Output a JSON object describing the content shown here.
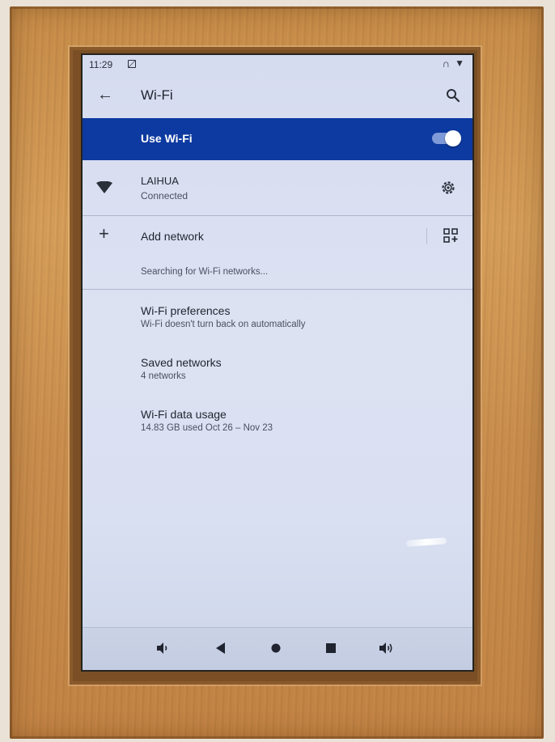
{
  "status_bar": {
    "time": "11:29",
    "notification_icon": "notification-square-icon",
    "right_icons": [
      "headset-icon",
      "wifi-icon"
    ]
  },
  "app_bar": {
    "title": "Wi-Fi",
    "back_icon": "back-arrow-icon",
    "search_icon": "search-icon"
  },
  "use_wifi": {
    "label": "Use Wi-Fi",
    "enabled": true
  },
  "connected_network": {
    "name": "LAIHUA",
    "status": "Connected"
  },
  "add_network": {
    "label": "Add network"
  },
  "searching_text": "Searching for Wi-Fi networks...",
  "preferences": [
    {
      "title": "Wi-Fi preferences",
      "subtitle": "Wi-Fi doesn't turn back on automatically"
    },
    {
      "title": "Saved networks",
      "subtitle": "4 networks"
    },
    {
      "title": "Wi-Fi data usage",
      "subtitle": "14.83 GB used Oct 26 – Nov 23"
    }
  ],
  "nav_bar": {
    "buttons": [
      "volume-down-icon",
      "back-triangle-icon",
      "home-circle-icon",
      "recents-square-icon",
      "volume-up-icon"
    ]
  },
  "colors": {
    "accent": "#0d3aa0",
    "screen_bg": "#d9e0f1",
    "frame_wood": "#d9a15c"
  }
}
